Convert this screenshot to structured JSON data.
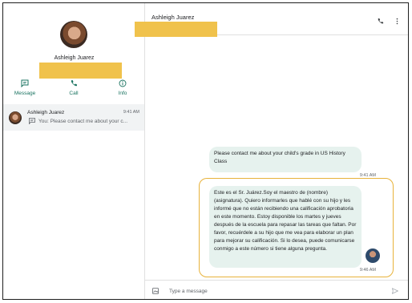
{
  "contact": {
    "name": "Ashleigh Juarez"
  },
  "actions": [
    {
      "label": "Message",
      "icon": "message-icon"
    },
    {
      "label": "Call",
      "icon": "phone-icon"
    },
    {
      "label": "Info",
      "icon": "info-icon"
    }
  ],
  "conversation_list": [
    {
      "name": "Ashleigh Juarez",
      "time": "9:41 AM",
      "snippet": "You: Please contact me about your c..."
    }
  ],
  "header": {
    "name": "Ashleigh Juarez",
    "icons": [
      "phone-icon",
      "more-vert-icon"
    ]
  },
  "messages": [
    {
      "text": "Please contact me about your child's grade in US History Class",
      "time": "9:41 AM"
    },
    {
      "text": "Este es el Sr. Juárez.Soy el maestro de (nombre) (asignatura). Quiero informarles que hablé con su hijo y les informé que no están recibiendo una calificación aprobatoria en este momento. Estoy disponible los martes y jueves después de la escuela para repasar las tareas que faltan. Por favor, recuérdele a su hijo que me vea para elaborar un plan para mejorar su calificación. Si lo desea, puede comunicarse conmigo a este número si tiene alguna pregunta.",
      "time": "9:46 AM"
    }
  ],
  "composer": {
    "placeholder": "Type a message",
    "value": ""
  },
  "colors": {
    "accent": "#1a7360",
    "bubble": "#e6f2ee",
    "highlight": "#e8b23a",
    "redaction": "#f0c24c"
  }
}
